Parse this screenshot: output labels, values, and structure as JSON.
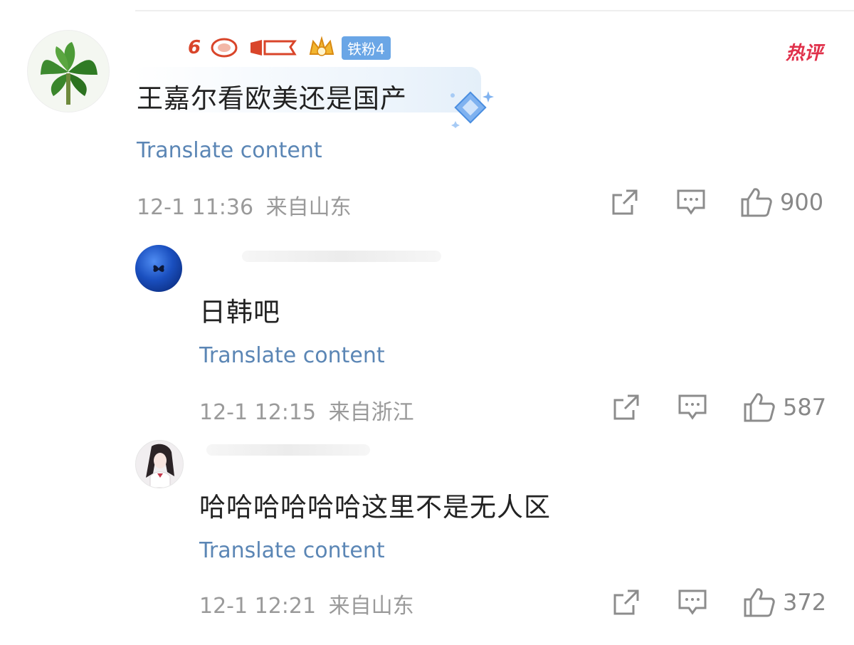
{
  "comments": [
    {
      "text": "王嘉尔看欧美还是国产",
      "translate": "Translate content",
      "time": "12-1 11:36",
      "location": "来自山东",
      "likes": "900",
      "fan_badge": "铁粉4",
      "hot_tag": "热评"
    },
    {
      "text": "日韩吧",
      "translate": "Translate content",
      "time": "12-1 12:15",
      "location": "来自浙江",
      "likes": "587"
    },
    {
      "text": "哈哈哈哈哈哈这里不是无人区",
      "translate": "Translate content",
      "time": "12-1 12:21",
      "location": "来自山东",
      "likes": "372"
    }
  ],
  "icons": {
    "share": "share-icon",
    "comment": "comment-icon",
    "like": "thumbs-up-icon"
  },
  "colors": {
    "translate_link": "#5b86b5",
    "hot_tag": "#e0304a",
    "fan_badge": "#6aa6e6"
  }
}
